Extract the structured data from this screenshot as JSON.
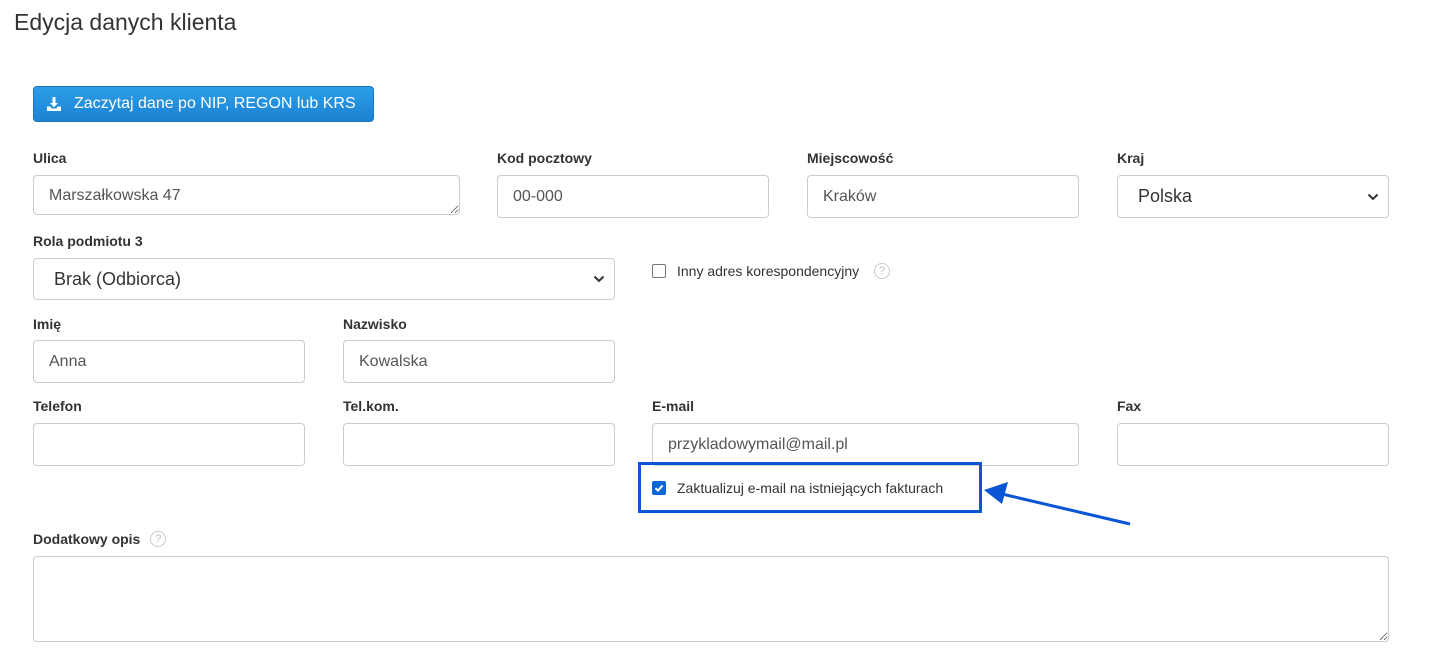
{
  "page": {
    "title": "Edycja danych klienta"
  },
  "actions": {
    "fetch_button_label": "Zaczytaj dane po NIP, REGON lub KRS"
  },
  "address": {
    "street_label": "Ulica",
    "street_value": "Marszałkowska 47",
    "postal_label": "Kod pocztowy",
    "postal_value": "00-000",
    "city_label": "Miejscowość",
    "city_value": "Kraków",
    "country_label": "Kraj",
    "country_value": "Polska"
  },
  "role": {
    "label": "Rola podmiotu 3",
    "value": "Brak (Odbiorca)"
  },
  "correspondence": {
    "checkbox_label": "Inny adres korespondencyjny",
    "checked": false,
    "help_icon": "question-circle-icon"
  },
  "person": {
    "first_name_label": "Imię",
    "first_name_value": "Anna",
    "last_name_label": "Nazwisko",
    "last_name_value": "Kowalska"
  },
  "contact": {
    "phone_label": "Telefon",
    "phone_value": "",
    "mobile_label": "Tel.kom.",
    "mobile_value": "",
    "email_label": "E-mail",
    "email_value": "przykladowymail@mail.pl",
    "fax_label": "Fax",
    "fax_value": ""
  },
  "email_update": {
    "checkbox_label": "Zaktualizuj e-mail na istniejących fakturach",
    "checked": true
  },
  "description": {
    "label": "Dodatkowy opis",
    "value": "",
    "help_icon": "question-circle-icon"
  },
  "colors": {
    "primary_button": "#1c82d2",
    "highlight": "#0a55d6",
    "checkbox_checked": "#0b66d8"
  }
}
